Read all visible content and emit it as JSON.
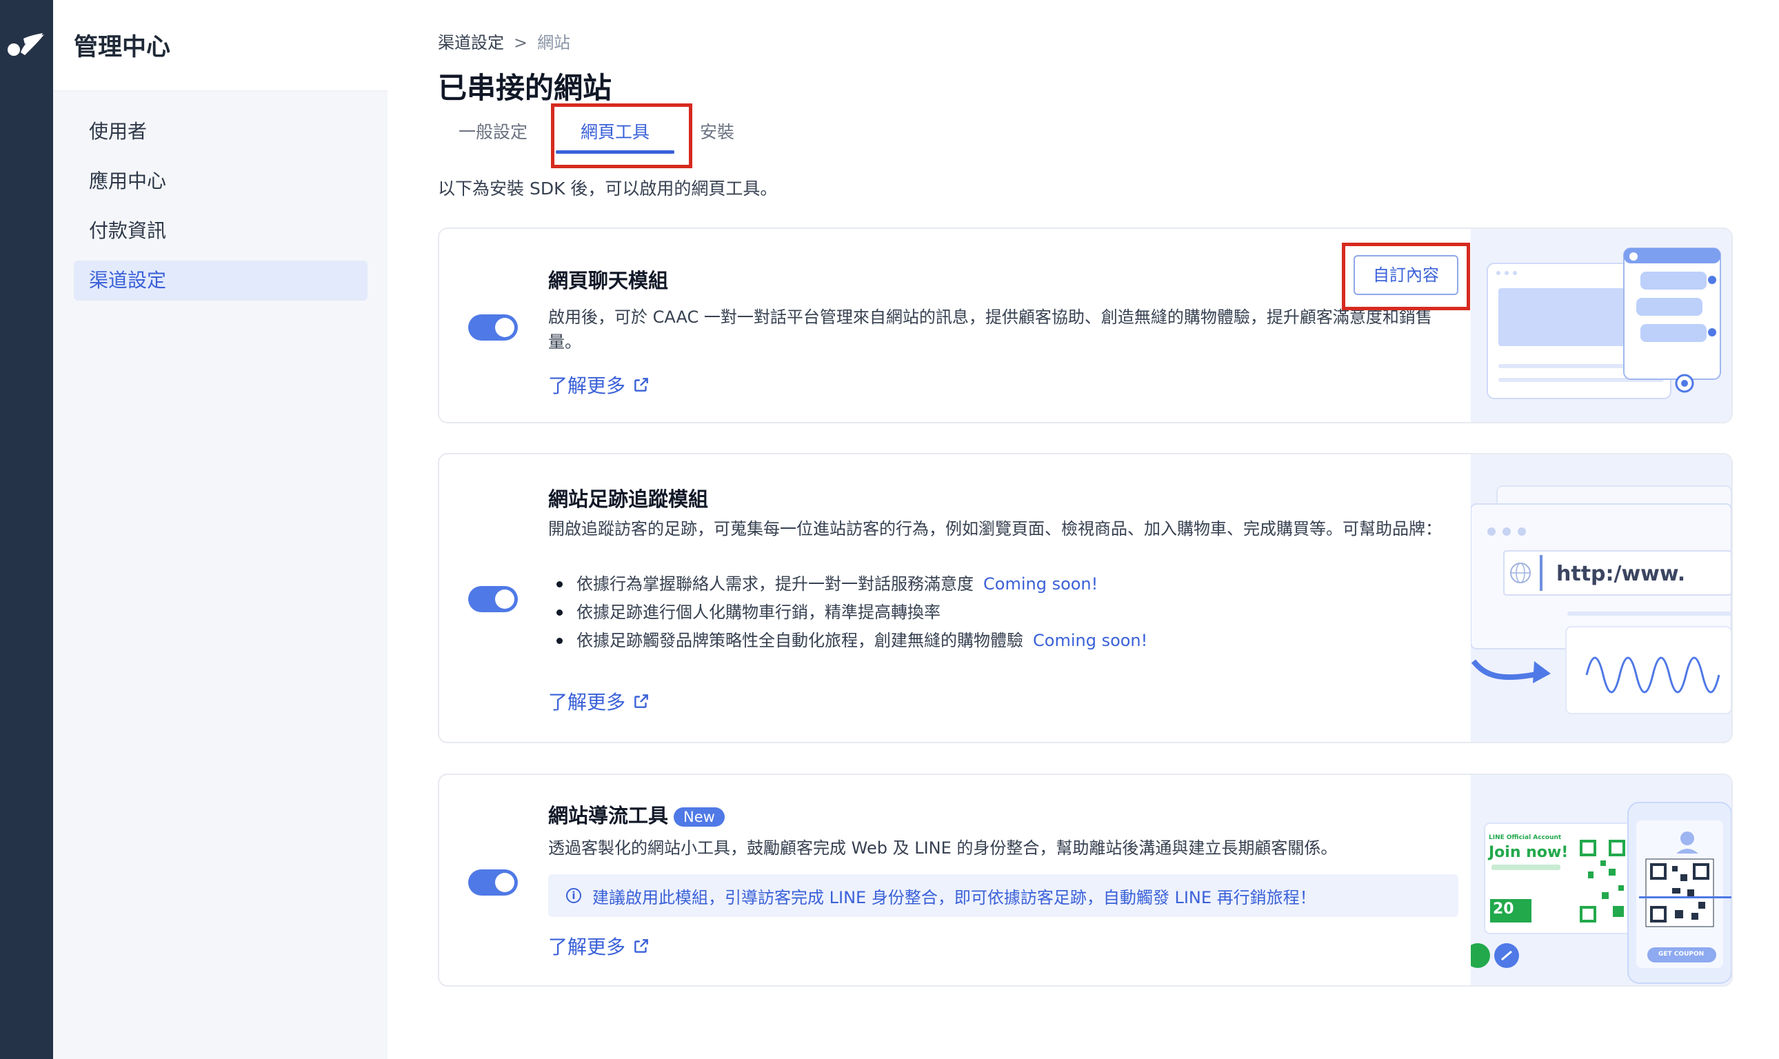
{
  "app": {
    "title": "管理中心"
  },
  "sidebar": {
    "items": [
      {
        "label": "使用者"
      },
      {
        "label": "應用中心"
      },
      {
        "label": "付款資訊"
      },
      {
        "label": "渠道設定"
      }
    ]
  },
  "breadcrumb": {
    "parent": "渠道設定",
    "separator": ">",
    "current": "網站"
  },
  "page": {
    "title": "已串接的網站",
    "intro": "以下為安裝 SDK 後，可以啟用的網頁工具。"
  },
  "tabs": [
    {
      "label": "一般設定"
    },
    {
      "label": "網頁工具"
    },
    {
      "label": "安裝"
    }
  ],
  "cards": {
    "chat": {
      "title": "網頁聊天模組",
      "desc": "啟用後，可於 CAAC 一對一對話平台管理來自網站的訊息，提供顧客協助、創造無縫的購物體驗，提升顧客滿意度和銷售量。",
      "custom_button": "自訂內容",
      "learn_more": "了解更多",
      "enabled": true
    },
    "tracking": {
      "title": "網站足跡追蹤模組",
      "desc": "開啟追蹤訪客的足跡，可蒐集每一位進站訪客的行為，例如瀏覽頁面、檢視商品、加入購物車、完成購買等。可幫助品牌：",
      "bullets": [
        {
          "text": "依據行為掌握聯絡人需求，提升一對一對話服務滿意度",
          "tag": "Coming soon!"
        },
        {
          "text": "依據足跡進行個人化購物車行銷，精準提高轉換率",
          "tag": ""
        },
        {
          "text": "依據足跡觸發品牌策略性全自動化旅程，創建無縫的購物體驗",
          "tag": "Coming soon!"
        }
      ],
      "learn_more": "了解更多",
      "illustration_url": "http:/www.",
      "enabled": true
    },
    "traffic": {
      "title": "網站導流工具",
      "badge": "New",
      "desc": "透過客製化的網站小工具，鼓勵顧客完成 Web 及 LINE 的身份整合，幫助離站後溝通與建立長期顧客關係。",
      "notice": "建議啟用此模組，引導訪客完成 LINE 身份整合，即可依據訪客足跡，自動觸發 LINE 再行銷旅程！",
      "learn_more": "了解更多",
      "illustration": {
        "line_official": "LINE Official Account",
        "join_now": "Join now!",
        "discount": "20",
        "coupon": "GET COUPON"
      },
      "enabled": true
    }
  },
  "colors": {
    "accent": "#3a61d8",
    "toggle_on": "#4f79e6",
    "highlight_box": "#d62a1f",
    "rail": "#253348"
  }
}
